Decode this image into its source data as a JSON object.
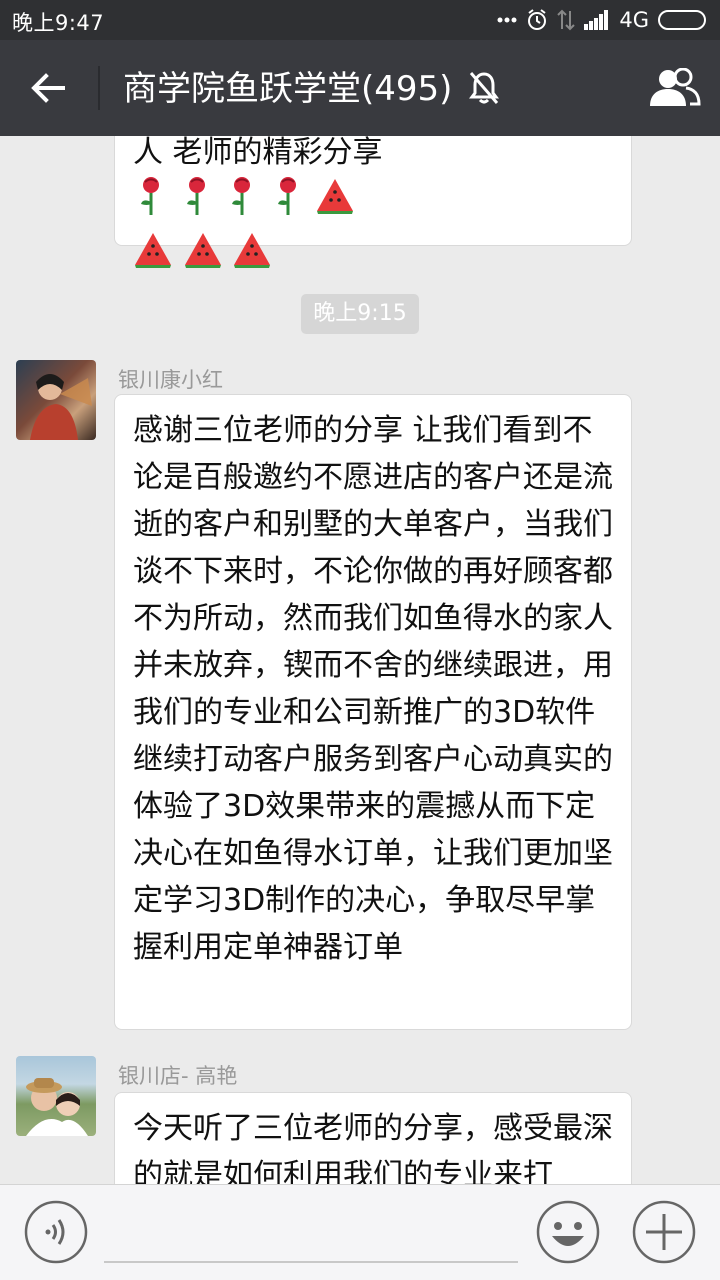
{
  "status_bar": {
    "time": "晚上9:47",
    "network": "4G"
  },
  "header": {
    "title": "商学院鱼跃学堂(495)",
    "icons": {
      "back": "back-arrow-icon",
      "mute": "bell-muted-icon",
      "members": "group-members-icon"
    }
  },
  "chat": {
    "partial_message": {
      "text": "人 老师的精彩分享",
      "emojis": [
        "rose",
        "rose",
        "rose",
        "rose",
        "watermelon",
        "watermelon",
        "watermelon",
        "watermelon"
      ]
    },
    "timestamp": "晚上9:15",
    "messages": [
      {
        "sender": "银川康小红",
        "text": "感谢三位老师的分享 让我们看到不论是百般邀约不愿进店的客户还是流逝的客户和别墅的大单客户，当我们谈不下来时，不论你做的再好顾客都不为所动，然而我们如鱼得水的家人并未放弃，锲而不舍的继续跟进，用我们的专业和公司新推广的3D软件继续打动客户服务到客户心动真实的体验了3D效果带来的震撼从而下定决心在如鱼得水订单，让我们更加坚定学习3D制作的决心，争取尽早掌握利用定单神器订单"
      },
      {
        "sender": "银川店- 高艳",
        "text": "今天听了三位老师的分享，感受最深的就是如何利用我们的专业来打"
      }
    ]
  },
  "input_bar": {
    "icons": {
      "voice": "voice-input-icon",
      "emoji": "emoji-icon",
      "more": "plus-icon"
    }
  },
  "colors": {
    "header_bg": "#393a3f",
    "chat_bg": "#ebebeb",
    "bubble_bg": "#ffffff"
  }
}
